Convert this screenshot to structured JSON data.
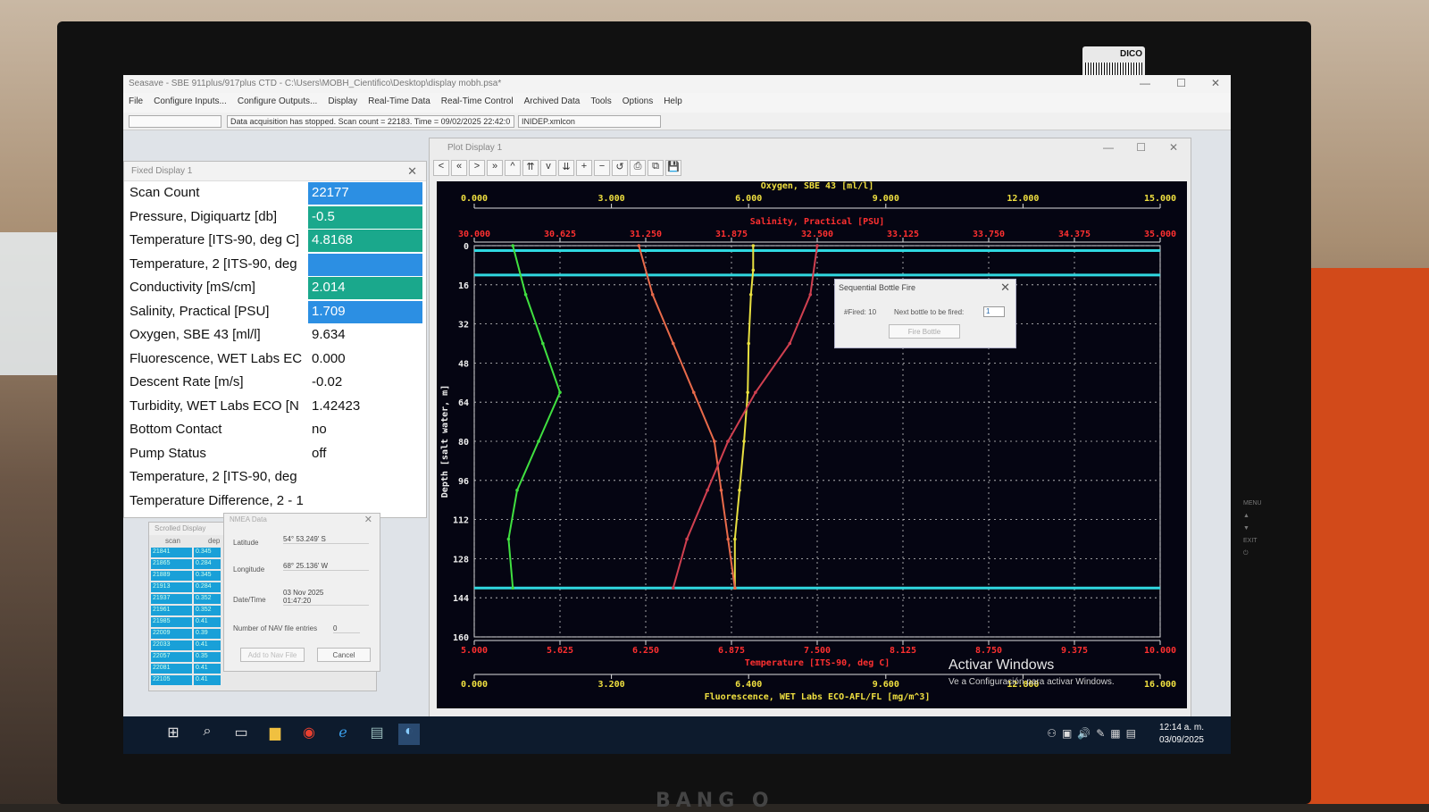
{
  "app": {
    "title": "Seasave - SBE 911plus/917plus CTD - C:\\Users\\MOBH_Cientifico\\Desktop\\display mobh.psa*",
    "menu": [
      "File",
      "Configure Inputs...",
      "Configure Outputs...",
      "Display",
      "Real-Time Data",
      "Real-Time Control",
      "Archived Data",
      "Tools",
      "Options",
      "Help"
    ],
    "status": "Data acquisition has stopped. Scan count = 22183. Time = 09/02/2025 22:42:0",
    "status_right": "INIDEP.xmlcon"
  },
  "fixed_display": {
    "title": "Fixed Display 1",
    "rows": [
      {
        "label": "Scan Count",
        "value": "22177",
        "color": "blue"
      },
      {
        "label": "Pressure, Digiquartz [db]",
        "value": "-0.5",
        "color": "teal"
      },
      {
        "label": "Temperature [ITS-90, deg C]",
        "value": "4.8168",
        "color": "teal"
      },
      {
        "label": "Temperature, 2 [ITS-90, deg",
        "value": "",
        "color": "blue"
      },
      {
        "label": "Conductivity [mS/cm]",
        "value": "2.014",
        "color": "teal"
      },
      {
        "label": "Salinity, Practical [PSU]",
        "value": "1.709",
        "color": "blue"
      },
      {
        "label": "Oxygen, SBE 43 [ml/l]",
        "value": "9.634",
        "color": "none"
      },
      {
        "label": "Fluorescence, WET Labs EC",
        "value": "0.000",
        "color": "none"
      },
      {
        "label": "Descent Rate [m/s]",
        "value": "-0.02",
        "color": "none"
      },
      {
        "label": "Turbidity, WET Labs ECO [N",
        "value": "1.42423",
        "color": "none"
      },
      {
        "label": "Bottom Contact",
        "value": "no",
        "color": "none"
      },
      {
        "label": "Pump Status",
        "value": "off",
        "color": "none"
      },
      {
        "label": "Temperature, 2 [ITS-90, deg",
        "value": "",
        "color": "none"
      },
      {
        "label": "Temperature Difference, 2 - 1",
        "value": "",
        "color": "none"
      }
    ]
  },
  "scrolled_display": {
    "title": "Scrolled Display",
    "col1": "scan",
    "col2": "dep",
    "rows": [
      [
        "21841",
        "0.345"
      ],
      [
        "21865",
        "0.284"
      ],
      [
        "21889",
        "0.345"
      ],
      [
        "21913",
        "0.284"
      ],
      [
        "21937",
        "0.352"
      ],
      [
        "21961",
        "0.352"
      ],
      [
        "21985",
        "0.41"
      ],
      [
        "22009",
        "0.39"
      ],
      [
        "22033",
        "0.41"
      ],
      [
        "22057",
        "0.35"
      ],
      [
        "22081",
        "0.41"
      ],
      [
        "22105",
        "0.41"
      ]
    ]
  },
  "nmea": {
    "title": "NMEA Data",
    "latitude_label": "Latitude",
    "latitude": "54° 53.249' S",
    "longitude_label": "Longitude",
    "longitude": "68° 25.136' W",
    "datetime_label": "Date/Time",
    "datetime": "03 Nov 2025\n01:47:20",
    "entries_label": "Number of NAV file entries",
    "entries": "0",
    "add_button": "Add to Nav File",
    "cancel_button": "Cancel"
  },
  "plot": {
    "title": "Plot Display 1",
    "toolbar": [
      "<",
      "«",
      ">",
      "»",
      "^",
      "⇈",
      "v",
      "⇊",
      "+",
      "−",
      "↺",
      "⎙",
      "⧉",
      "💾"
    ],
    "oxygen_label": "Oxygen, SBE 43 [ml/l]",
    "salinity_label": "Salinity, Practical [PSU]",
    "temperature_label": "Temperature [ITS-90, deg C]",
    "fluorescence_label": "Fluorescence, WET Labs ECO-AFL/FL [mg/m^3]",
    "depth_label": "Depth [salt water, m]"
  },
  "chart_data": {
    "type": "line",
    "y_axis": {
      "label": "Depth [salt water, m]",
      "range": [
        0,
        160
      ],
      "ticks": [
        "0",
        "16",
        "32",
        "48",
        "64",
        "80",
        "96",
        "112",
        "128",
        "144",
        "160"
      ]
    },
    "x_axes": [
      {
        "name": "Oxygen, SBE 43 [ml/l]",
        "range": [
          0,
          15
        ],
        "ticks": [
          "0.000",
          "3.000",
          "6.000",
          "9.000",
          "12.000",
          "15.000"
        ],
        "color": "#f0e040"
      },
      {
        "name": "Salinity, Practical [PSU]",
        "range": [
          30,
          35
        ],
        "ticks": [
          "30.000",
          "30.625",
          "31.250",
          "31.875",
          "32.500",
          "33.125",
          "33.750",
          "34.375",
          "35.000"
        ],
        "color": "#ff3030"
      },
      {
        "name": "Temperature [ITS-90, deg C]",
        "range": [
          5,
          10
        ],
        "ticks": [
          "5.000",
          "5.625",
          "6.250",
          "6.875",
          "7.500",
          "8.125",
          "8.750",
          "9.375",
          "10.000"
        ],
        "color": "#ff3030"
      },
      {
        "name": "Fluorescence, WET Labs ECO-AFL/FL [mg/m^3]",
        "range": [
          0,
          16
        ],
        "ticks": [
          "0.000",
          "3.200",
          "6.400",
          "9.600",
          "12.800",
          "16.000"
        ],
        "color": "#f0e040"
      }
    ],
    "series": [
      {
        "name": "Oxygen, SBE 43 [ml/l]",
        "color": "#e8e040",
        "points": [
          [
            6.1,
            0
          ],
          [
            6.1,
            10
          ],
          [
            6.05,
            20
          ],
          [
            6.0,
            40
          ],
          [
            5.98,
            60
          ],
          [
            5.9,
            80
          ],
          [
            5.8,
            100
          ],
          [
            5.7,
            120
          ],
          [
            5.7,
            140
          ]
        ]
      },
      {
        "name": "Salinity, Practical [PSU]",
        "color": "#e86a4a",
        "points": [
          [
            31.2,
            0
          ],
          [
            31.3,
            20
          ],
          [
            31.45,
            40
          ],
          [
            31.6,
            60
          ],
          [
            31.75,
            80
          ],
          [
            31.8,
            100
          ],
          [
            31.85,
            120
          ],
          [
            31.9,
            140
          ]
        ]
      },
      {
        "name": "Temperature [ITS-90, deg C]",
        "color": "#d04050",
        "points": [
          [
            7.5,
            0
          ],
          [
            7.45,
            20
          ],
          [
            7.3,
            40
          ],
          [
            7.05,
            60
          ],
          [
            6.85,
            80
          ],
          [
            6.7,
            100
          ],
          [
            6.55,
            120
          ],
          [
            6.45,
            140
          ]
        ]
      },
      {
        "name": "Fluorescence, WET Labs ECO-AFL/FL [mg/m^3]",
        "color": "#40e040",
        "points": [
          [
            0.9,
            0
          ],
          [
            1.2,
            20
          ],
          [
            1.6,
            40
          ],
          [
            2.0,
            60
          ],
          [
            1.5,
            80
          ],
          [
            1.0,
            100
          ],
          [
            0.8,
            120
          ],
          [
            0.9,
            140
          ]
        ]
      }
    ],
    "reference_depths": [
      2,
      12,
      140
    ]
  },
  "bottle_dialog": {
    "title": "Sequential Bottle Fire",
    "fired": "#Fired: 10",
    "next_label": "Next bottle to be fired:",
    "next_value": "1",
    "fire_button": "Fire Bottle"
  },
  "watermark": {
    "line1": "Activar Windows",
    "line2": "Ve a Configuración para activar Windows."
  },
  "taskbar": {
    "time": "12:14 a. m.",
    "date": "03/09/2025"
  },
  "monitor": {
    "brand": "BANG O",
    "sticker": "DICO"
  }
}
